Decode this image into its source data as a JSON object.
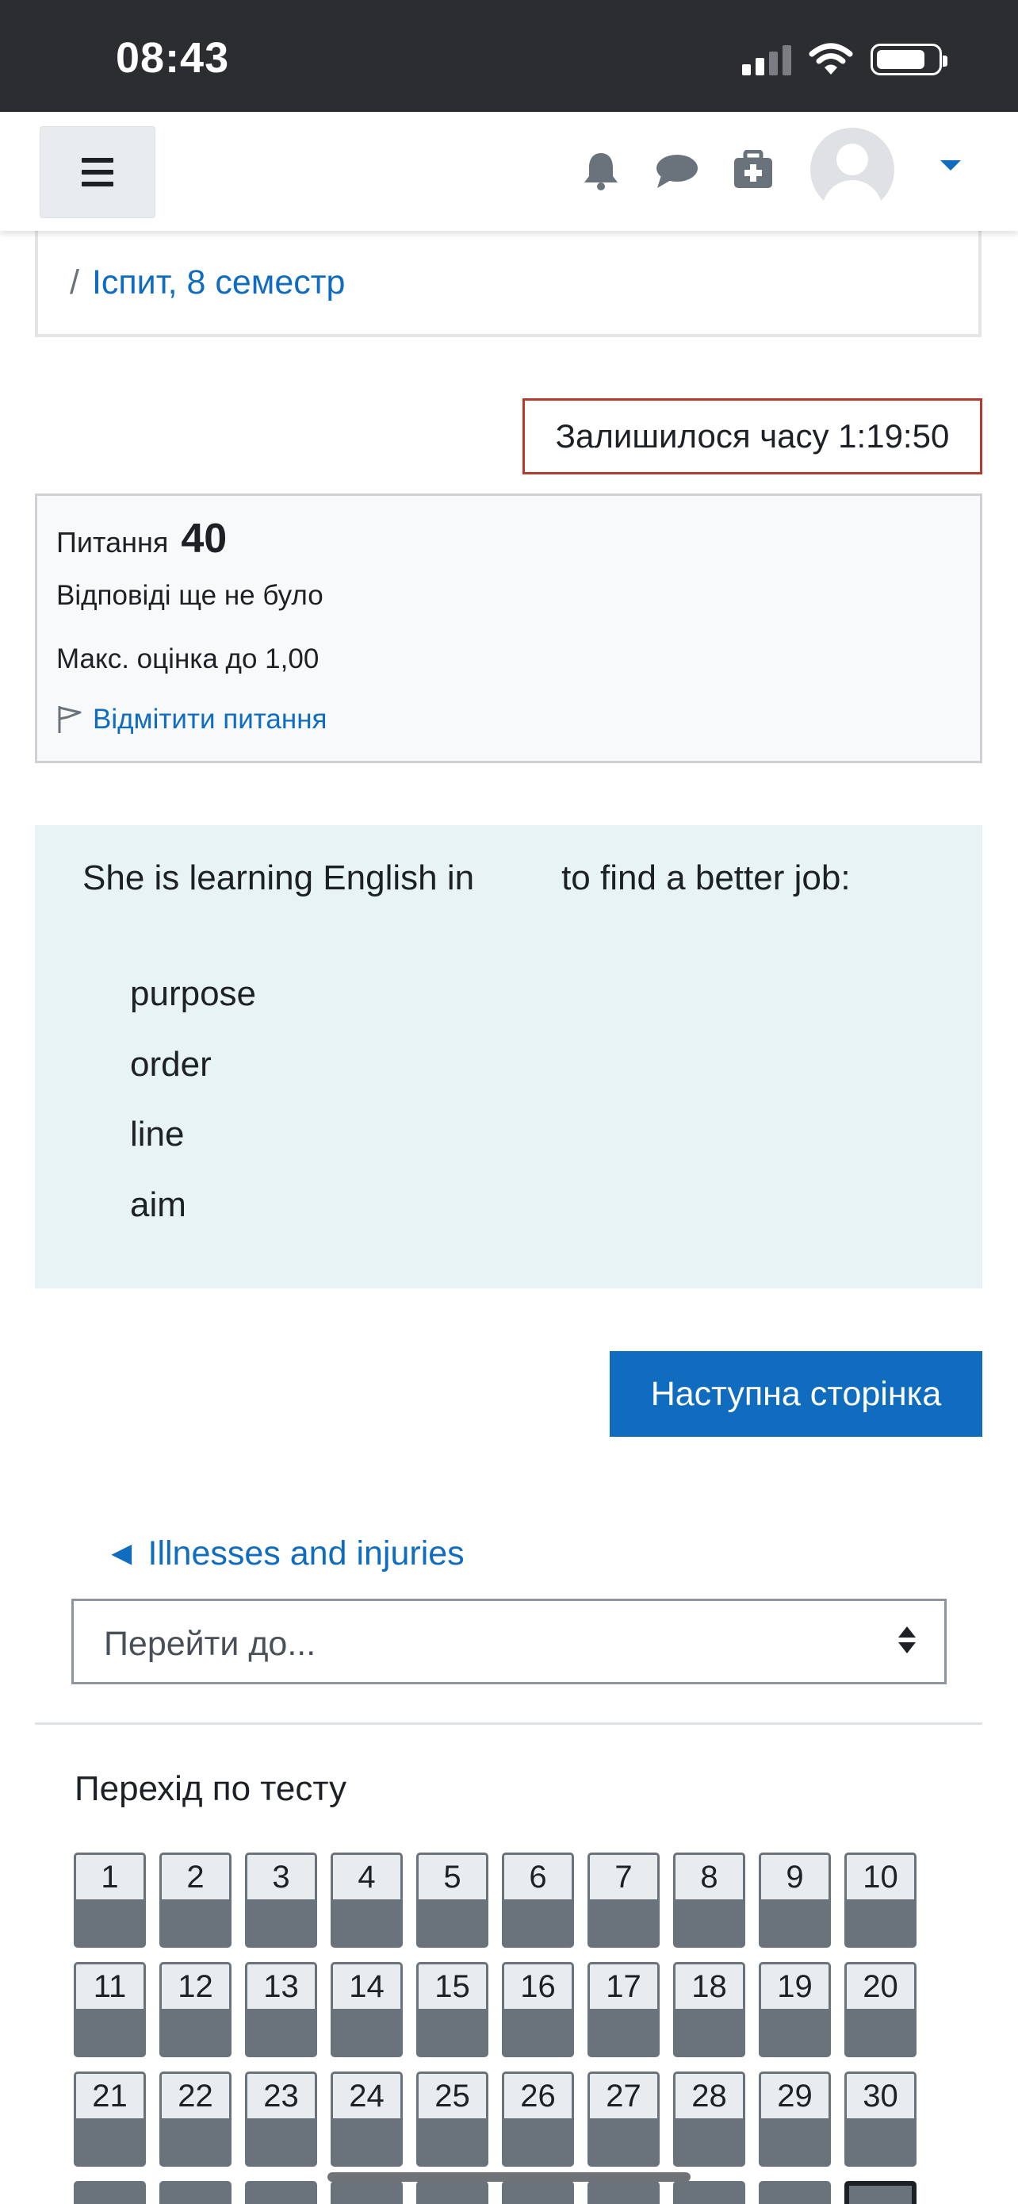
{
  "status_bar": {
    "time": "08:43",
    "signal_icon": "cellular-signal-icon",
    "wifi_icon": "wifi-icon",
    "battery_icon": "battery-icon"
  },
  "navbar": {
    "menu_icon": "hamburger-menu-icon",
    "icons": [
      "bell-icon",
      "chat-bubble-icon",
      "first-aid-kit-icon",
      "avatar-icon",
      "caret-down-icon"
    ],
    "accent_color": "#0f6cbf"
  },
  "breadcrumb": {
    "separator": "/",
    "current": "Іспит, 8 семестр"
  },
  "timer": {
    "label": "Залишилося часу 1:19:50",
    "border_color": "#b63a2c"
  },
  "question_info": {
    "label": "Питання",
    "number": "40",
    "state": "Відповіді ще не було",
    "max_grade": "Макс. оцінка до 1,00",
    "flag_label": "Відмітити питання"
  },
  "question": {
    "prompt_before": "She is learning English in",
    "prompt_after": "to find a better job:",
    "options": [
      "purpose",
      "order",
      "line",
      "aim"
    ],
    "background": "#e7f3f5"
  },
  "next_button": {
    "label": "Наступна сторінка"
  },
  "activity_nav": {
    "prev_link": "◄ Illnesses and injuries",
    "jump_placeholder": "Перейти до..."
  },
  "quiz_navigation": {
    "title": "Перехід по тесту",
    "visible_numbers": [
      "1",
      "2",
      "3",
      "4",
      "5",
      "6",
      "7",
      "8",
      "9",
      "10",
      "11",
      "12",
      "13",
      "14",
      "15",
      "16",
      "17",
      "18",
      "19",
      "20",
      "21",
      "22",
      "23",
      "24",
      "25",
      "26",
      "27",
      "28",
      "29",
      "30"
    ],
    "current": "40"
  }
}
